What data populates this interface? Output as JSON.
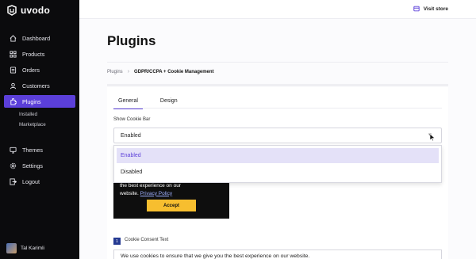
{
  "brand": {
    "name": "uvodo"
  },
  "sidebar": {
    "items": [
      {
        "label": "Dashboard",
        "icon": "home-icon"
      },
      {
        "label": "Products",
        "icon": "grid-icon"
      },
      {
        "label": "Orders",
        "icon": "orders-icon"
      },
      {
        "label": "Customers",
        "icon": "users-icon"
      },
      {
        "label": "Plugins",
        "icon": "plugin-icon",
        "active": true
      },
      {
        "label": "Themes",
        "icon": "themes-icon"
      },
      {
        "label": "Settings",
        "icon": "settings-icon"
      },
      {
        "label": "Logout",
        "icon": "logout-icon"
      }
    ],
    "plugins_sub": [
      "Installed",
      "Marketplace"
    ],
    "user": {
      "name": "Tal Karimli"
    }
  },
  "topbar": {
    "visit_store": "Visit store"
  },
  "page": {
    "title": "Plugins",
    "breadcrumb": {
      "root": "Plugins",
      "separator": "›",
      "current": "GDPR/CCPA + Cookie Management"
    }
  },
  "tabs": [
    "General",
    "Design"
  ],
  "cookie_bar": {
    "label": "Show Cookie Bar",
    "selected": "Enabled",
    "options": [
      "Enabled",
      "Disabled"
    ]
  },
  "preview": {
    "line1": "the best experience on our",
    "line2_prefix": "website.",
    "link": "Privacy Policy",
    "accept": "Accept"
  },
  "consent": {
    "number": "1",
    "label": "Cookie Consent Text",
    "value": "We use cookies to ensure that we give you the best experience on our website."
  },
  "colors": {
    "accent": "#5b3fd9",
    "accept_button": "#f7be2f",
    "sidebar_bg": "#0b0b0d"
  }
}
